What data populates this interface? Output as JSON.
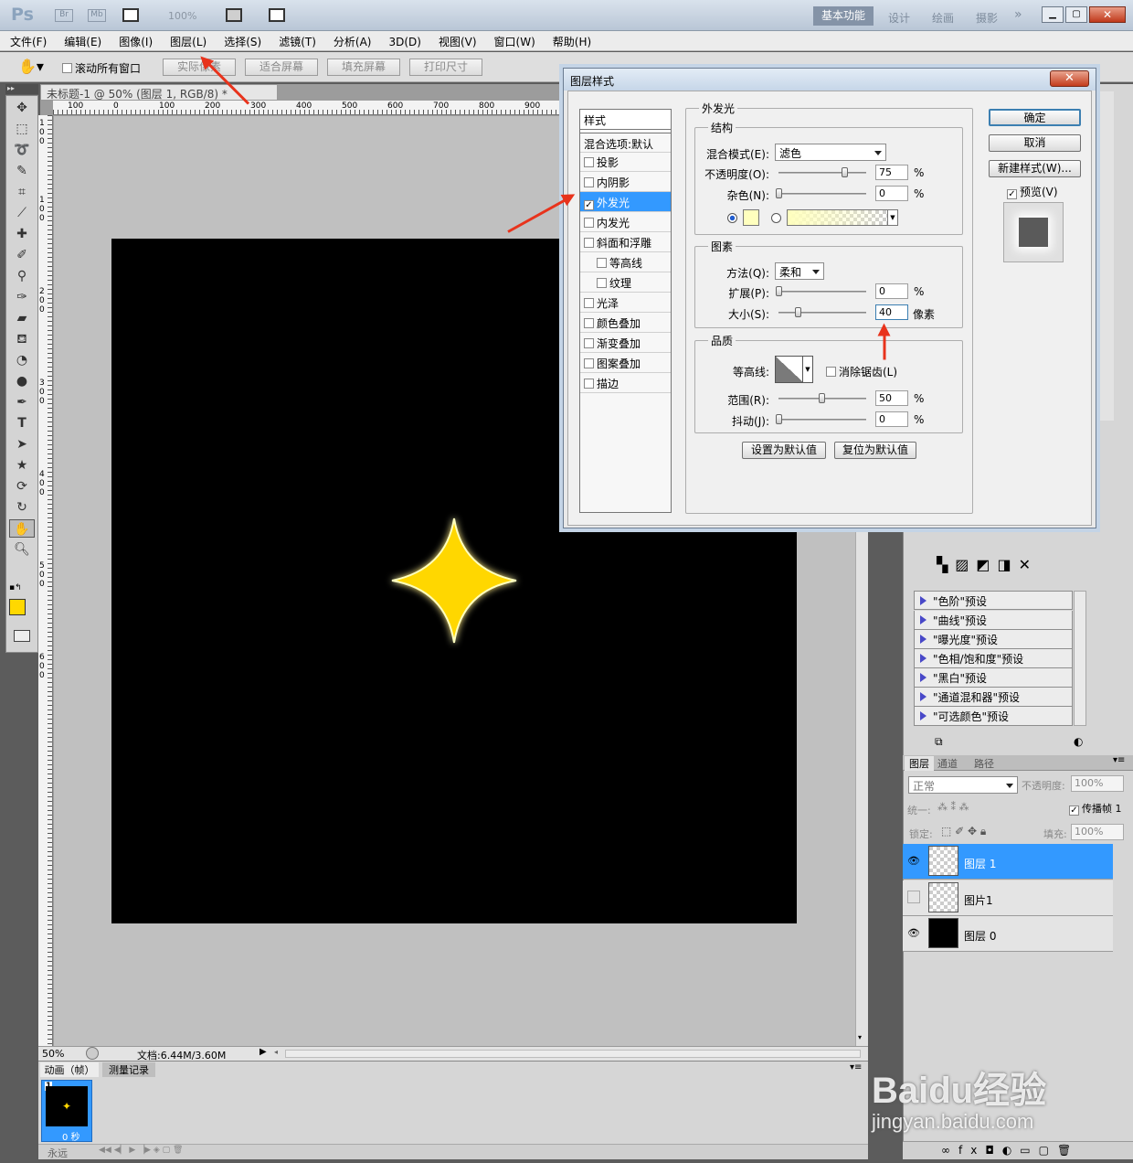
{
  "app": {
    "logo": "Ps",
    "zoom": "100%",
    "workspaces": [
      "基本功能",
      "设计",
      "绘画",
      "摄影"
    ]
  },
  "menu": [
    "文件(F)",
    "编辑(E)",
    "图像(I)",
    "图层(L)",
    "选择(S)",
    "滤镜(T)",
    "分析(A)",
    "3D(D)",
    "视图(V)",
    "窗口(W)",
    "帮助(H)"
  ],
  "options": {
    "scroll_all": "滚动所有窗口",
    "actual_pixels": "实际像素",
    "fit_screen": "适合屏幕",
    "fill_screen": "填充屏幕",
    "print_size": "打印尺寸"
  },
  "document": {
    "tab_title": "未标题-1 @ 50% (图层 1, RGB/8) *",
    "zoom_status": "50%",
    "doc_size": "文档:6.44M/3.60M",
    "ruler_h": [
      "100",
      "0",
      "100",
      "200",
      "300",
      "400",
      "500",
      "600",
      "700",
      "800",
      "900"
    ],
    "ruler_v": [
      "1",
      "0",
      "0",
      "1",
      "0",
      "0",
      "2",
      "0",
      "0",
      "3",
      "0",
      "0",
      "4",
      "0",
      "0",
      "5",
      "0",
      "0",
      "6",
      "0",
      "0"
    ]
  },
  "colors": {
    "foreground": "#ffd800",
    "background": "#9b00d6",
    "star": "#ffd700",
    "glow": "#ffffbe",
    "accent": "#3399ff"
  },
  "dialog": {
    "title": "图层样式",
    "styles_header": "样式",
    "blend_default": "混合选项:默认",
    "styles": [
      {
        "label": "投影",
        "checked": false,
        "indent": false
      },
      {
        "label": "内阴影",
        "checked": false,
        "indent": false
      },
      {
        "label": "外发光",
        "checked": true,
        "indent": false,
        "selected": true
      },
      {
        "label": "内发光",
        "checked": false,
        "indent": false
      },
      {
        "label": "斜面和浮雕",
        "checked": false,
        "indent": false
      },
      {
        "label": "等高线",
        "checked": false,
        "indent": true
      },
      {
        "label": "纹理",
        "checked": false,
        "indent": true
      },
      {
        "label": "光泽",
        "checked": false,
        "indent": false
      },
      {
        "label": "颜色叠加",
        "checked": false,
        "indent": false
      },
      {
        "label": "渐变叠加",
        "checked": false,
        "indent": false
      },
      {
        "label": "图案叠加",
        "checked": false,
        "indent": false
      },
      {
        "label": "描边",
        "checked": false,
        "indent": false
      }
    ],
    "section_title": "外发光",
    "structure": {
      "title": "结构",
      "blend_mode_label": "混合模式(E):",
      "blend_mode": "滤色",
      "opacity_label": "不透明度(O):",
      "opacity": "75",
      "noise_label": "杂色(N):",
      "noise": "0",
      "percent": "%"
    },
    "elements": {
      "title": "图素",
      "method_label": "方法(Q):",
      "method": "柔和",
      "spread_label": "扩展(P):",
      "spread": "0",
      "size_label": "大小(S):",
      "size": "40",
      "size_unit": "像素"
    },
    "quality": {
      "title": "品质",
      "contour_label": "等高线:",
      "antialias": "消除锯齿(L)",
      "range_label": "范围(R):",
      "range": "50",
      "jitter_label": "抖动(J):",
      "jitter": "0"
    },
    "set_default": "设置为默认值",
    "reset_default": "复位为默认值",
    "ok": "确定",
    "cancel": "取消",
    "new_style": "新建样式(W)...",
    "preview": "预览(V)"
  },
  "presets": [
    "\"色阶\"预设",
    "\"曲线\"预设",
    "\"曝光度\"预设",
    "\"色相/饱和度\"预设",
    "\"黑白\"预设",
    "\"通道混和器\"预设",
    "\"可选颜色\"预设"
  ],
  "layers_panel": {
    "tabs": [
      "图层",
      "通道",
      "路径"
    ],
    "blend": "正常",
    "opacity_label": "不透明度:",
    "opacity": "100%",
    "unify_label": "统一:",
    "propagate": "传播帧 1",
    "lock_label": "锁定:",
    "fill_label": "填充:",
    "fill": "100%",
    "layers": [
      {
        "name": "图层 1",
        "visible": true,
        "selected": true,
        "thumb": "transparent"
      },
      {
        "name": "图片1",
        "visible": false,
        "selected": false,
        "thumb": "transparent"
      },
      {
        "name": "图层 0",
        "visible": true,
        "selected": false,
        "thumb": "black"
      }
    ]
  },
  "animation": {
    "tabs": [
      "动画（帧）",
      "测量记录"
    ],
    "frame_number": "1",
    "frame_delay": "0 秒",
    "loop": "永远"
  },
  "watermark": {
    "brand": "Baidu经验",
    "url": "jingyan.baidu.com"
  }
}
